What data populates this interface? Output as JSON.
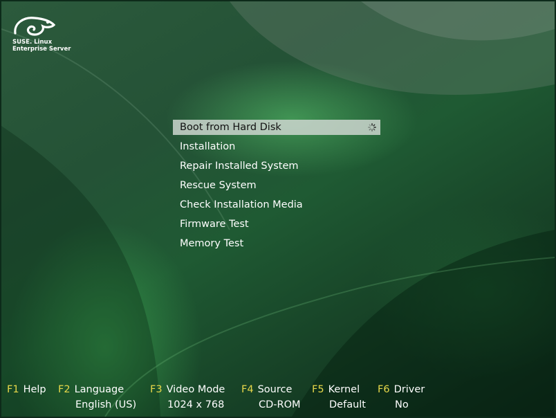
{
  "brand": {
    "line1": "SUSE. Linux",
    "line2": "Enterprise Server"
  },
  "menu": {
    "items": [
      {
        "label": "Boot from Hard Disk"
      },
      {
        "label": "Installation"
      },
      {
        "label": "Repair Installed System"
      },
      {
        "label": "Rescue System"
      },
      {
        "label": "Check Installation Media"
      },
      {
        "label": "Firmware Test"
      },
      {
        "label": "Memory Test"
      }
    ],
    "selected_index": 0
  },
  "function_keys": [
    {
      "key": "F1",
      "label": "Help",
      "value": ""
    },
    {
      "key": "F2",
      "label": "Language",
      "value": "English (US)"
    },
    {
      "key": "F3",
      "label": "Video Mode",
      "value": "1024 x 768"
    },
    {
      "key": "F4",
      "label": "Source",
      "value": "CD-ROM"
    },
    {
      "key": "F5",
      "label": "Kernel",
      "value": "Default"
    },
    {
      "key": "F6",
      "label": "Driver",
      "value": "No"
    }
  ],
  "colors": {
    "key_color": "#e8d84a",
    "selected_bg": "#cdd6cf",
    "text": "#ffffff"
  },
  "icons": {
    "logo": "suse-chameleon-logo",
    "busy": "spinner-icon"
  }
}
